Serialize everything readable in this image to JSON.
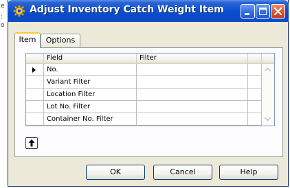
{
  "window": {
    "title": "Adjust Inventory Catch Weight Item",
    "left_edge_glyphs": [
      "e",
      ":",
      "o"
    ]
  },
  "tabs": [
    {
      "label": "Item",
      "active": true
    },
    {
      "label": "Options",
      "active": false
    }
  ],
  "grid": {
    "columns": [
      "Field",
      "Filter"
    ],
    "rows": [
      {
        "field": "No.",
        "filter": "",
        "current": true
      },
      {
        "field": "Variant Filter",
        "filter": ""
      },
      {
        "field": "Location Filter",
        "filter": ""
      },
      {
        "field": "Lot No. Filter",
        "filter": ""
      },
      {
        "field": "Container No. Filter",
        "filter": ""
      }
    ]
  },
  "buttons": {
    "ok": "OK",
    "cancel": "Cancel",
    "help": "Help"
  },
  "colors": {
    "titlebar": "#0a48c6",
    "dialog_bg": "#ece9d8",
    "close_button": "#d8532c",
    "active_tab_accent": "#ffc83c"
  },
  "icons": {
    "title": "gear-icon",
    "row_pointer": "row-pointer-icon",
    "lookup": "up-arrow-icon",
    "scroll_up": "scroll-up-icon",
    "scroll_down": "scroll-down-icon",
    "bottom": "up-arrow-icon"
  }
}
